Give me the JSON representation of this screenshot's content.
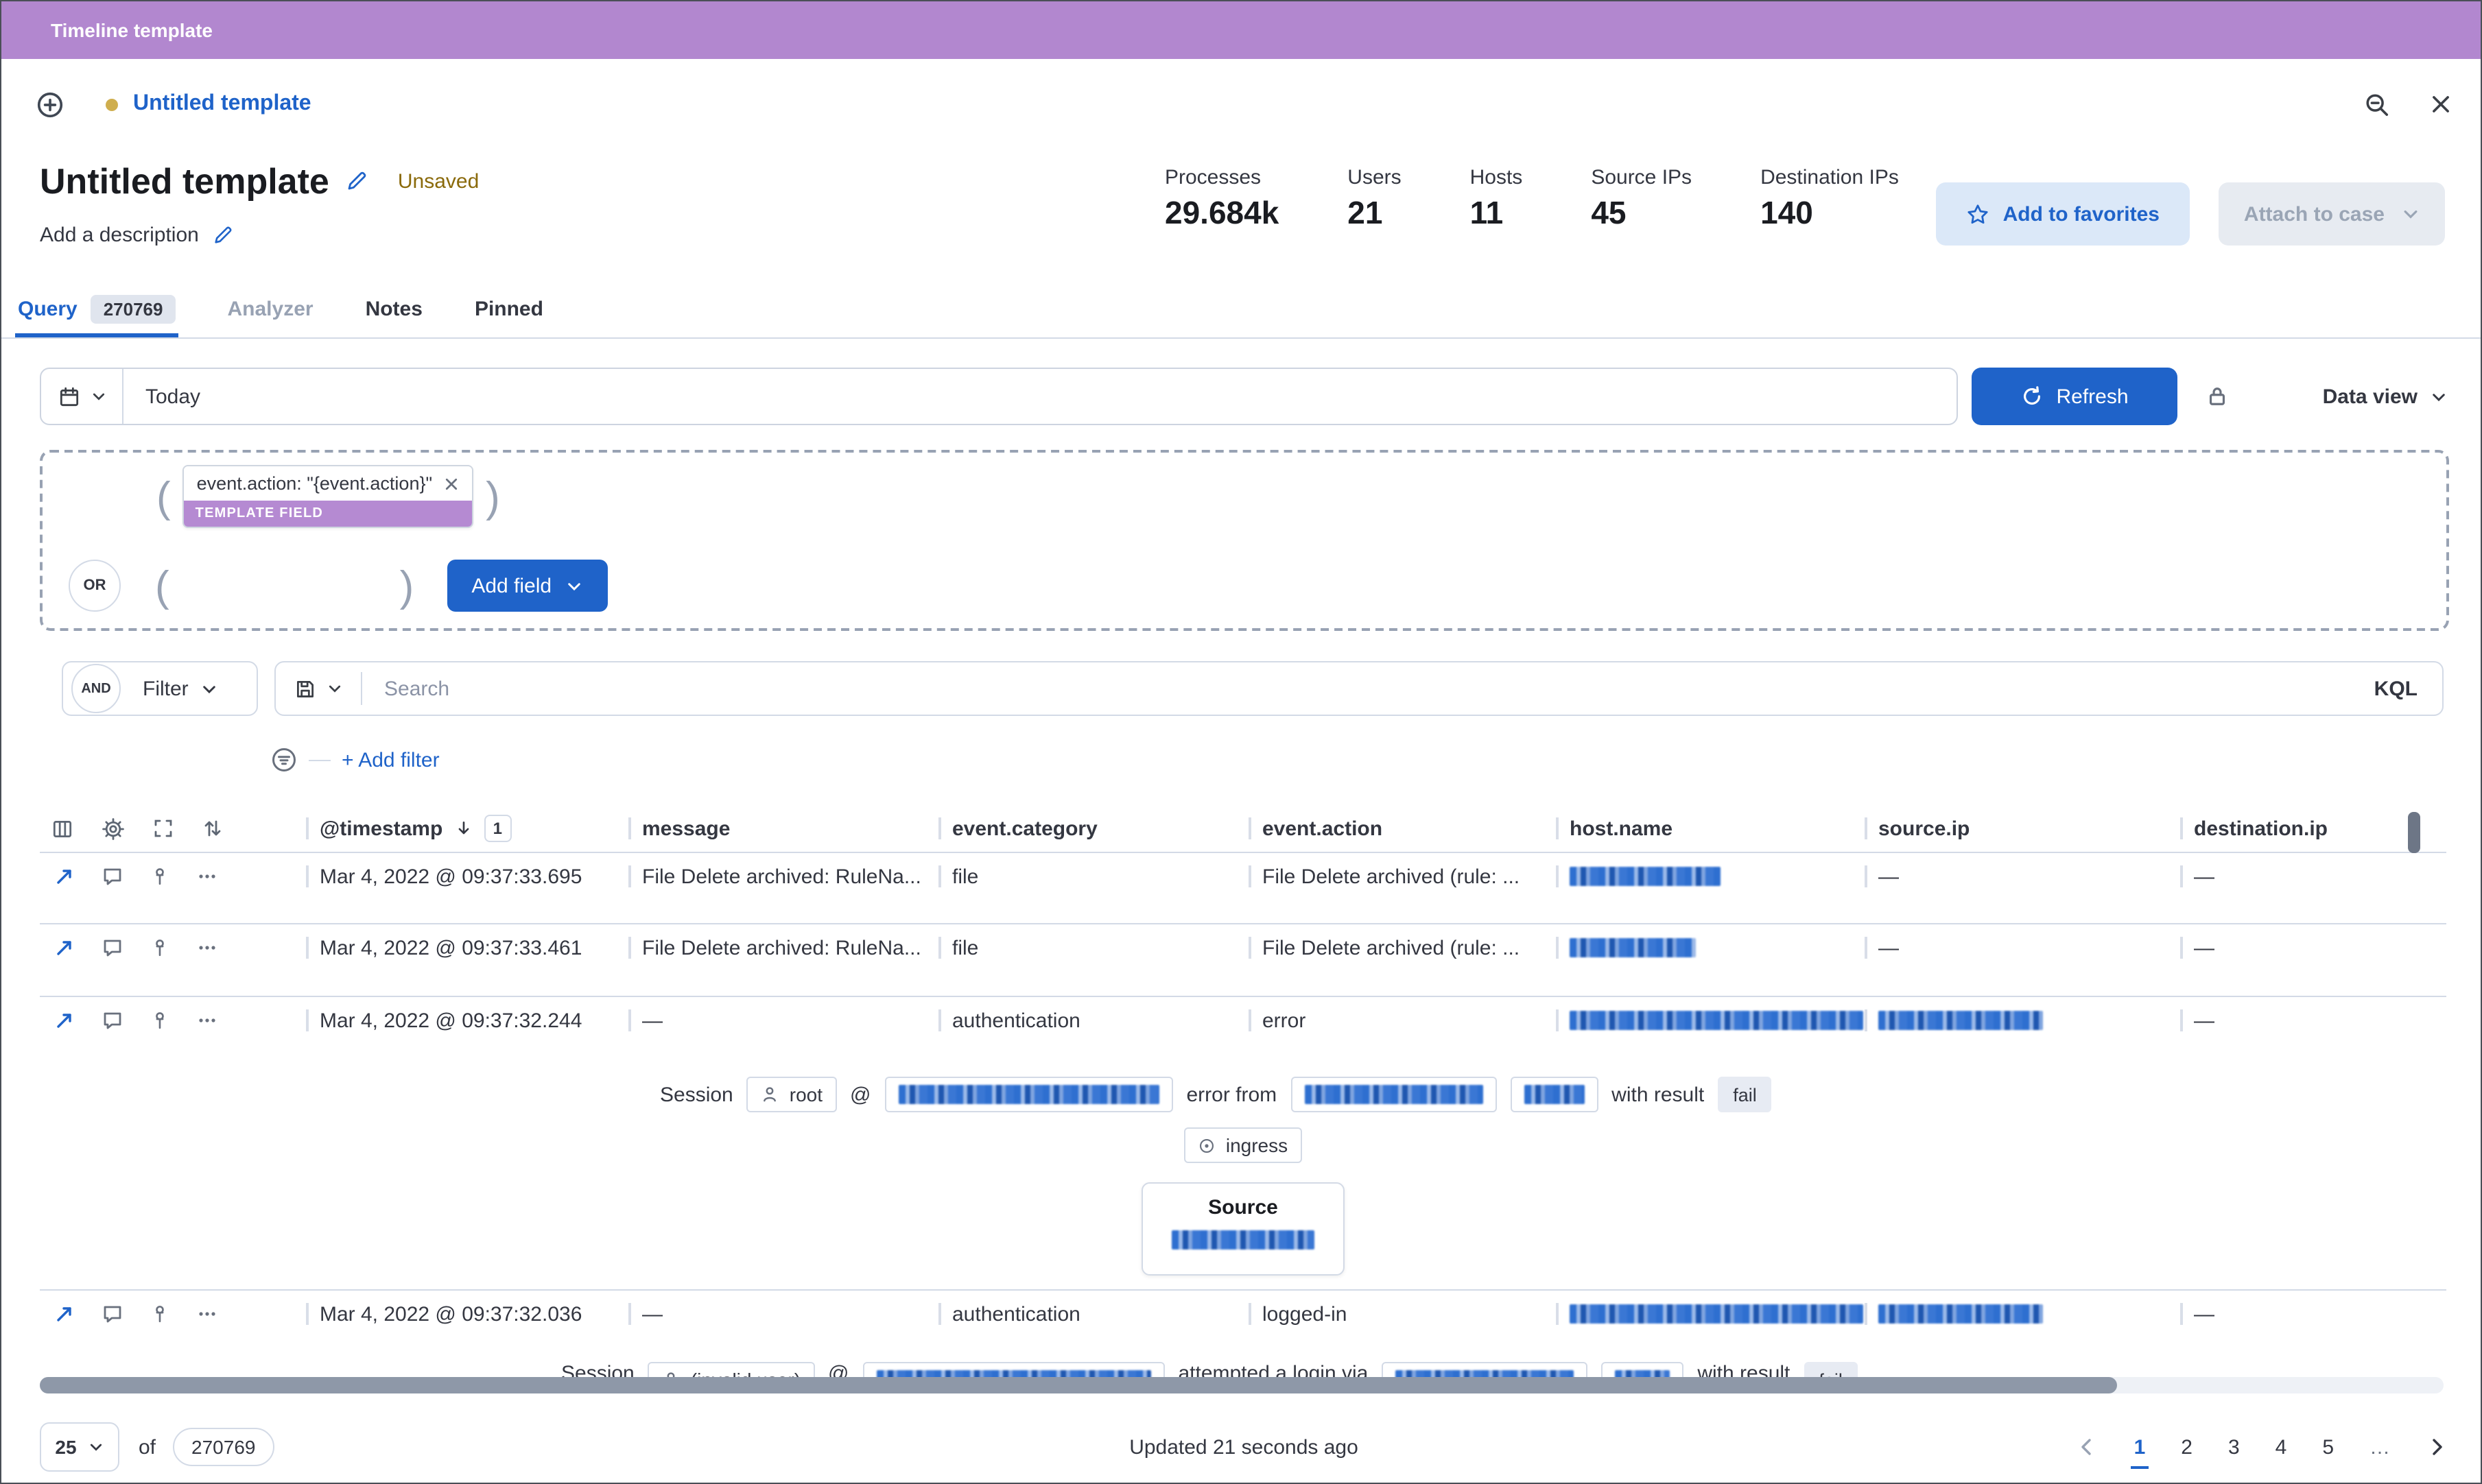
{
  "topbar": {
    "title": "Timeline template"
  },
  "nav": {
    "timeline_link": "Untitled template"
  },
  "header": {
    "title": "Untitled template",
    "unsaved": "Unsaved",
    "description": "Add a description",
    "stats": [
      {
        "label": "Processes",
        "value": "29.684k"
      },
      {
        "label": "Users",
        "value": "21"
      },
      {
        "label": "Hosts",
        "value": "11"
      },
      {
        "label": "Source IPs",
        "value": "45"
      },
      {
        "label": "Destination IPs",
        "value": "140"
      }
    ],
    "favorites_button": "Add to favorites",
    "attach_button": "Attach to case"
  },
  "tabs": {
    "query": "Query",
    "query_count": "270769",
    "analyzer": "Analyzer",
    "notes": "Notes",
    "pinned": "Pinned"
  },
  "toolbar": {
    "date_range": "Today",
    "refresh_button": "Refresh",
    "data_view": "Data view"
  },
  "builder": {
    "field_pill": "event.action: \"{event.action}\"",
    "pill_tag": "TEMPLATE FIELD",
    "or": "OR",
    "add_field_button": "Add field"
  },
  "filters": {
    "and": "AND",
    "filter": "Filter",
    "search_placeholder": "Search",
    "kql": "KQL",
    "add_filter": "+ Add filter"
  },
  "table": {
    "columns": {
      "timestamp": "@timestamp",
      "sort_badge": "1",
      "message": "message",
      "category": "event.category",
      "action": "event.action",
      "host": "host.name",
      "source": "source.ip",
      "destination": "destination.ip"
    },
    "rows": [
      {
        "timestamp": "Mar 4, 2022 @ 09:37:33.695",
        "message": "File Delete archived: RuleNa...",
        "category": "file",
        "action": "File Delete archived (rule: ...",
        "source": "—",
        "destination": "—"
      },
      {
        "timestamp": "Mar 4, 2022 @ 09:37:33.461",
        "message": "File Delete archived: RuleNa...",
        "category": "file",
        "action": "File Delete archived (rule: ...",
        "source": "—",
        "destination": "—"
      },
      {
        "timestamp": "Mar 4, 2022 @ 09:37:32.244",
        "message": "—",
        "category": "authentication",
        "action": "error",
        "destination": "—",
        "renderer": {
          "session": "Session",
          "user": "root",
          "at": "@",
          "verb": "error from",
          "with_result": "with result",
          "result": "fail",
          "direction": "ingress",
          "source_title": "Source"
        }
      },
      {
        "timestamp": "Mar 4, 2022 @ 09:37:32.036",
        "message": "—",
        "category": "authentication",
        "action": "logged-in",
        "destination": "—",
        "renderer": {
          "session": "Session",
          "user": "(invalid user)",
          "at": "@",
          "verb": "attempted a login via",
          "with_result": "with result",
          "result": "fail"
        }
      }
    ]
  },
  "footer": {
    "page_size": "25",
    "of": "of",
    "total": "270769",
    "updated": "Updated 21 seconds ago",
    "pages": [
      "1",
      "2",
      "3",
      "4",
      "5"
    ],
    "ellipsis": "…"
  }
}
